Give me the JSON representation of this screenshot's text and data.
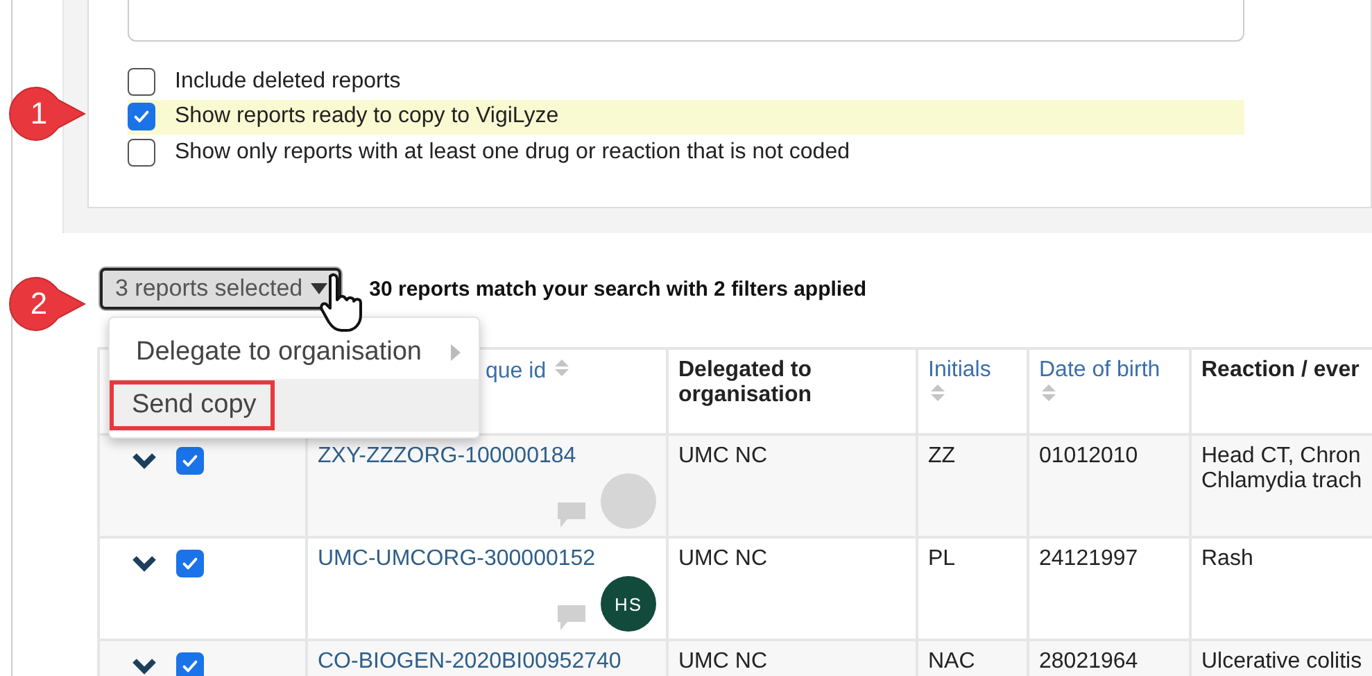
{
  "filters": [
    {
      "label": "Include deleted reports",
      "checked": false,
      "highlighted": false
    },
    {
      "label": "Show reports ready to copy to VigiLyze",
      "checked": true,
      "highlighted": true
    },
    {
      "label": "Show only reports with at least one drug or reaction that is not coded",
      "checked": false,
      "highlighted": false
    }
  ],
  "callouts": [
    {
      "number": "1"
    },
    {
      "number": "2"
    }
  ],
  "selection_button": {
    "label": "3 reports selected"
  },
  "result_summary": "30 reports match your search with 2 filters applied",
  "menu": [
    {
      "label": "Delegate to organisation",
      "kind": "submenu",
      "highlighted": false
    },
    {
      "label": "Send copy",
      "kind": "action",
      "highlighted": true
    }
  ],
  "table": {
    "columns": [
      {
        "label": "que id",
        "sortable": true
      },
      {
        "label": "Delegated to organisation",
        "sortable": false
      },
      {
        "label": "Initials",
        "sortable": true
      },
      {
        "label": "Date of birth",
        "sortable": true
      },
      {
        "label": "Reaction / ever",
        "sortable": false
      }
    ],
    "rows": [
      {
        "checked": true,
        "id": "ZXY-ZZZORG-100000184",
        "organisation": "UMC NC",
        "initials": "ZZ",
        "date_of_birth": "01012010",
        "reaction": [
          "Head CT, Chron",
          "Chlamydia trach"
        ]
      },
      {
        "checked": true,
        "id": "UMC-UMCORG-300000152",
        "avatar_initials": "HS",
        "organisation": "UMC NC",
        "initials": "PL",
        "date_of_birth": "24121997",
        "reaction": [
          "Rash"
        ]
      },
      {
        "checked": true,
        "id": "CO-BIOGEN-2020BI00952740",
        "organisation": "UMC NC",
        "initials": "NAC",
        "date_of_birth": "28021964",
        "reaction": [
          "Ulcerative colitis"
        ]
      }
    ]
  }
}
